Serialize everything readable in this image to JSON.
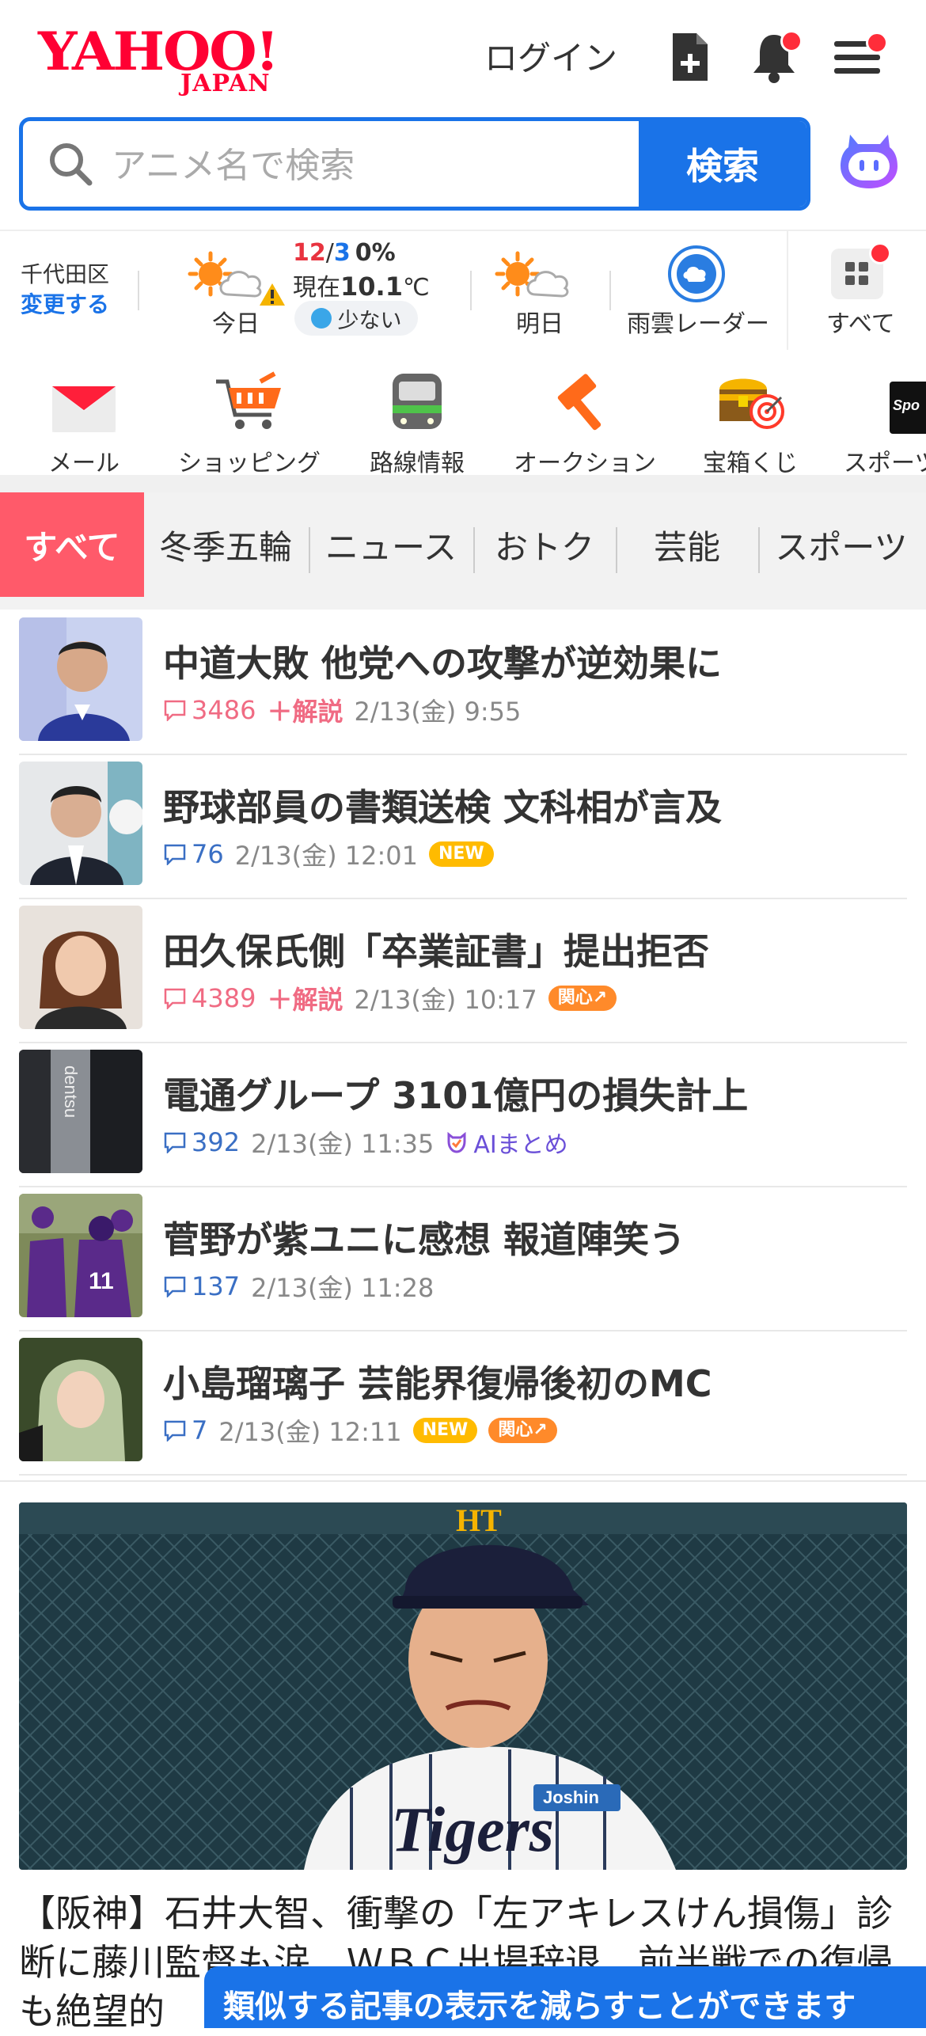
{
  "header": {
    "logo_text": "YAHOO!",
    "logo_sub": "JAPAN",
    "login_label": "ログイン",
    "icons": [
      "document-add-icon",
      "bell-icon",
      "menu-icon"
    ]
  },
  "search": {
    "placeholder": "アニメ名で検索",
    "button_label": "検索"
  },
  "weather": {
    "city": "千代田区",
    "change_label": "変更する",
    "today": {
      "label": "今日",
      "high": "12",
      "sep": "/",
      "low": "3",
      "rain": "0%",
      "now_prefix": "現在",
      "now_temp": "10.1",
      "now_unit": "℃",
      "pollen": "少ない"
    },
    "tomorrow_label": "明日",
    "radar_label": "雨雲レーダー",
    "all_label": "すべて",
    "colors": {
      "high": "#e8333f",
      "low": "#1a73e8"
    }
  },
  "services": [
    {
      "label": "メール",
      "icon": "mail-icon"
    },
    {
      "label": "ショッピング",
      "icon": "shopping-cart-icon"
    },
    {
      "label": "路線情報",
      "icon": "train-icon"
    },
    {
      "label": "オークション",
      "icon": "auction-hammer-icon"
    },
    {
      "label": "宝箱くじ",
      "icon": "treasure-box-icon"
    },
    {
      "label": "スポーツ",
      "icon": "sports-icon"
    }
  ],
  "tabs": [
    "すべて",
    "冬季五輪",
    "ニュース",
    "おトク",
    "芸能",
    "スポーツ"
  ],
  "news": [
    {
      "title": "中道大敗 他党への攻撃が逆効果に",
      "comments": "3486",
      "kaisetsu": "＋解説",
      "time": "2/13(金) 9:55"
    },
    {
      "title": "野球部員の書類送検 文科相が言及",
      "comments": "76",
      "time": "2/13(金) 12:01",
      "badge": "NEW"
    },
    {
      "title": "田久保氏側「卒業証書」提出拒否",
      "comments": "4389",
      "kaisetsu": "＋解説",
      "time": "2/13(金) 10:17",
      "badge": "関心↗"
    },
    {
      "title": "電通グループ 3101億円の損失計上",
      "comments": "392",
      "time": "2/13(金) 11:35",
      "ai": "AIまとめ"
    },
    {
      "title": "菅野が紫ユニに感想 報道陣笑う",
      "comments": "137",
      "time": "2/13(金) 11:28"
    },
    {
      "title": "小島瑠璃子 芸能界復帰後初のMC",
      "comments": "7",
      "time": "2/13(金) 12:11",
      "badge": "NEW",
      "badge2": "関心↗"
    }
  ],
  "feature": {
    "headline": "【阪神】石井大智、衝撃の「左アキレスけん損傷」診断に藤川監督も涙　ＷＢＣ出場辞退、前半戦での復帰も絶望的",
    "cap_letters": "HT",
    "jersey_text": "Tigers",
    "patch_text": "Joshin"
  },
  "toast": "類似する記事の表示を減らすことができます"
}
